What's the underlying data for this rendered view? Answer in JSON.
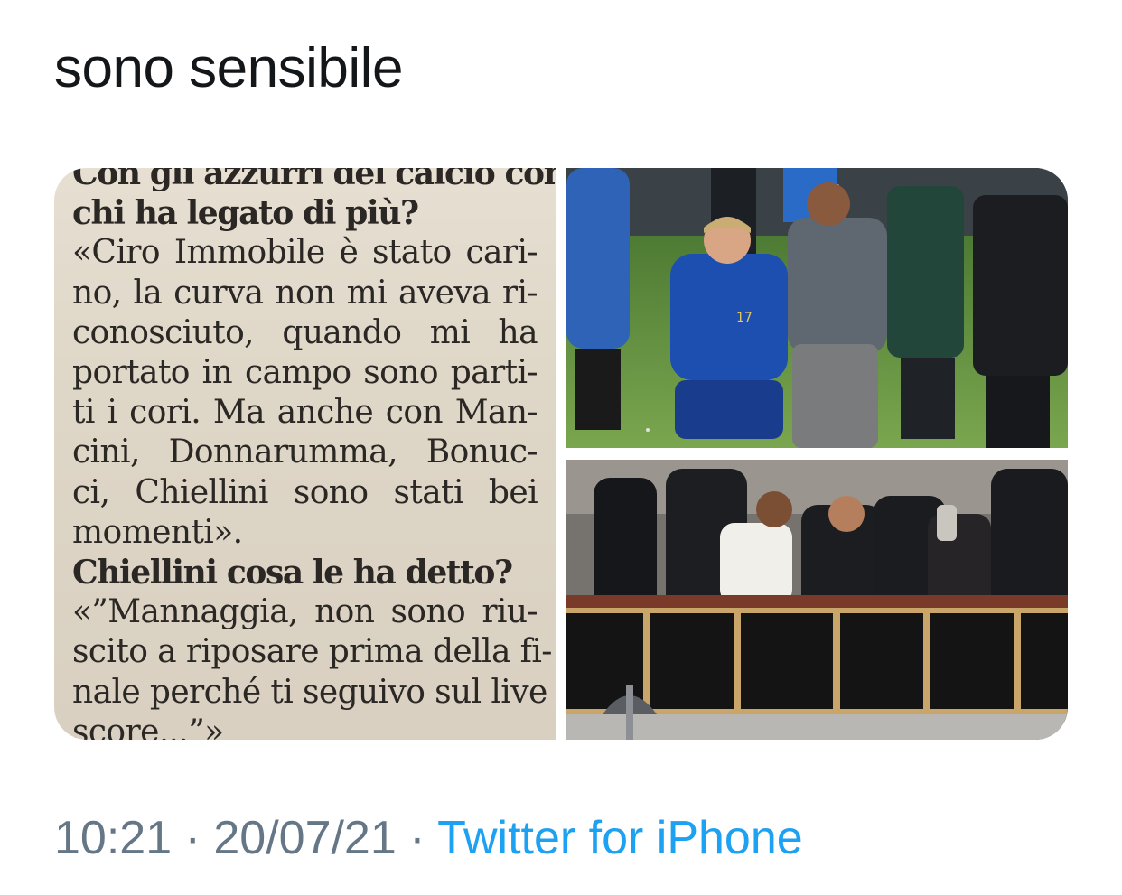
{
  "tweet": {
    "text": "sono sensibile"
  },
  "media": {
    "newspaper_lines": [
      {
        "text": "Con gli azzurri del calcio con",
        "bold": true,
        "justify": false
      },
      {
        "text": "chi ha legato di più?",
        "bold": true,
        "justify": false
      },
      {
        "text": "«Ciro Immobile è stato cari-",
        "bold": false,
        "justify": true
      },
      {
        "text": "no, la curva non mi aveva ri-",
        "bold": false,
        "justify": true
      },
      {
        "text": "conosciuto, quando mi ha",
        "bold": false,
        "justify": true
      },
      {
        "text": "portato in campo sono parti-",
        "bold": false,
        "justify": true
      },
      {
        "text": "ti i cori. Ma anche con Man-",
        "bold": false,
        "justify": true
      },
      {
        "text": "cini, Donnarumma, Bonuc-",
        "bold": false,
        "justify": true
      },
      {
        "text": "ci, Chiellini sono stati bei",
        "bold": false,
        "justify": true
      },
      {
        "text": "momenti».",
        "bold": false,
        "justify": false
      },
      {
        "text": "Chiellini cosa le ha detto?",
        "bold": true,
        "justify": false
      },
      {
        "text": "«”Mannaggia, non sono riu-",
        "bold": false,
        "justify": true
      },
      {
        "text": "scito a riposare prima della fi-",
        "bold": false,
        "justify": true
      },
      {
        "text": "nale perché ti seguivo sul live",
        "bold": false,
        "justify": true
      },
      {
        "text": "score...”»",
        "bold": false,
        "justify": false
      }
    ],
    "player_shirt_number": "17"
  },
  "meta": {
    "time": "10:21",
    "separator": " · ",
    "date": "20/07/21",
    "source": "Twitter for iPhone"
  },
  "colors": {
    "text": "#14171a",
    "secondary": "#657786",
    "link": "#1da1f2",
    "italy_blue": "#1d4fb0",
    "pitch_green": "#5f8a3e"
  }
}
